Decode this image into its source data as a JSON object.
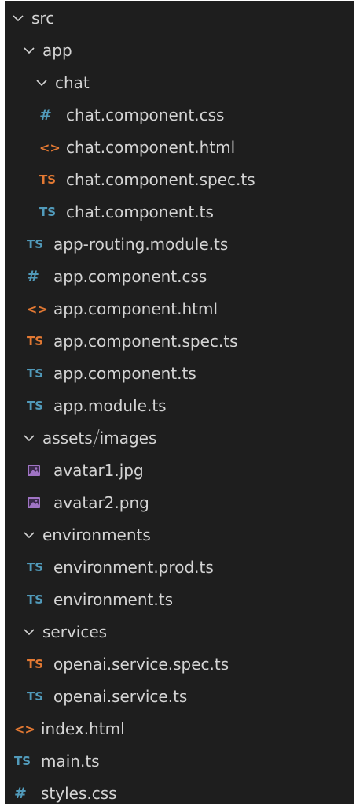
{
  "colors": {
    "background": "#1e1e1e",
    "text": "#d4d4d4",
    "ts_icon": "#519aba",
    "ts_spec_icon": "#e37933",
    "css_icon": "#519aba",
    "html_icon": "#e37933",
    "image_icon": "#a074c4"
  },
  "tree": {
    "src": {
      "label": "src",
      "icon": "chevron-down"
    },
    "app": {
      "label": "app",
      "icon": "chevron-down"
    },
    "chat": {
      "label": "chat",
      "icon": "chevron-down"
    },
    "chat_css": {
      "label": "chat.component.css",
      "icon_text": "#"
    },
    "chat_html": {
      "label": "chat.component.html",
      "icon_text": "<>"
    },
    "chat_spec": {
      "label": "chat.component.spec.ts",
      "icon_text": "TS"
    },
    "chat_ts": {
      "label": "chat.component.ts",
      "icon_text": "TS"
    },
    "app_routing": {
      "label": "app-routing.module.ts",
      "icon_text": "TS"
    },
    "app_css": {
      "label": "app.component.css",
      "icon_text": "#"
    },
    "app_html": {
      "label": "app.component.html",
      "icon_text": "<>"
    },
    "app_spec": {
      "label": "app.component.spec.ts",
      "icon_text": "TS"
    },
    "app_ts": {
      "label": "app.component.ts",
      "icon_text": "TS"
    },
    "app_module": {
      "label": "app.module.ts",
      "icon_text": "TS"
    },
    "assets": {
      "label": "assets",
      "sublabel": "images",
      "icon": "chevron-down"
    },
    "avatar1": {
      "label": "avatar1.jpg",
      "icon": "image-icon"
    },
    "avatar2": {
      "label": "avatar2.png",
      "icon": "image-icon"
    },
    "environments": {
      "label": "environments",
      "icon": "chevron-down"
    },
    "env_prod": {
      "label": "environment.prod.ts",
      "icon_text": "TS"
    },
    "env": {
      "label": "environment.ts",
      "icon_text": "TS"
    },
    "services": {
      "label": "services",
      "icon": "chevron-down"
    },
    "openai_spec": {
      "label": "openai.service.spec.ts",
      "icon_text": "TS"
    },
    "openai": {
      "label": "openai.service.ts",
      "icon_text": "TS"
    },
    "index_html": {
      "label": "index.html",
      "icon_text": "<>"
    },
    "main_ts": {
      "label": "main.ts",
      "icon_text": "TS"
    },
    "styles_css": {
      "label": "styles.css",
      "icon_text": "#"
    }
  }
}
